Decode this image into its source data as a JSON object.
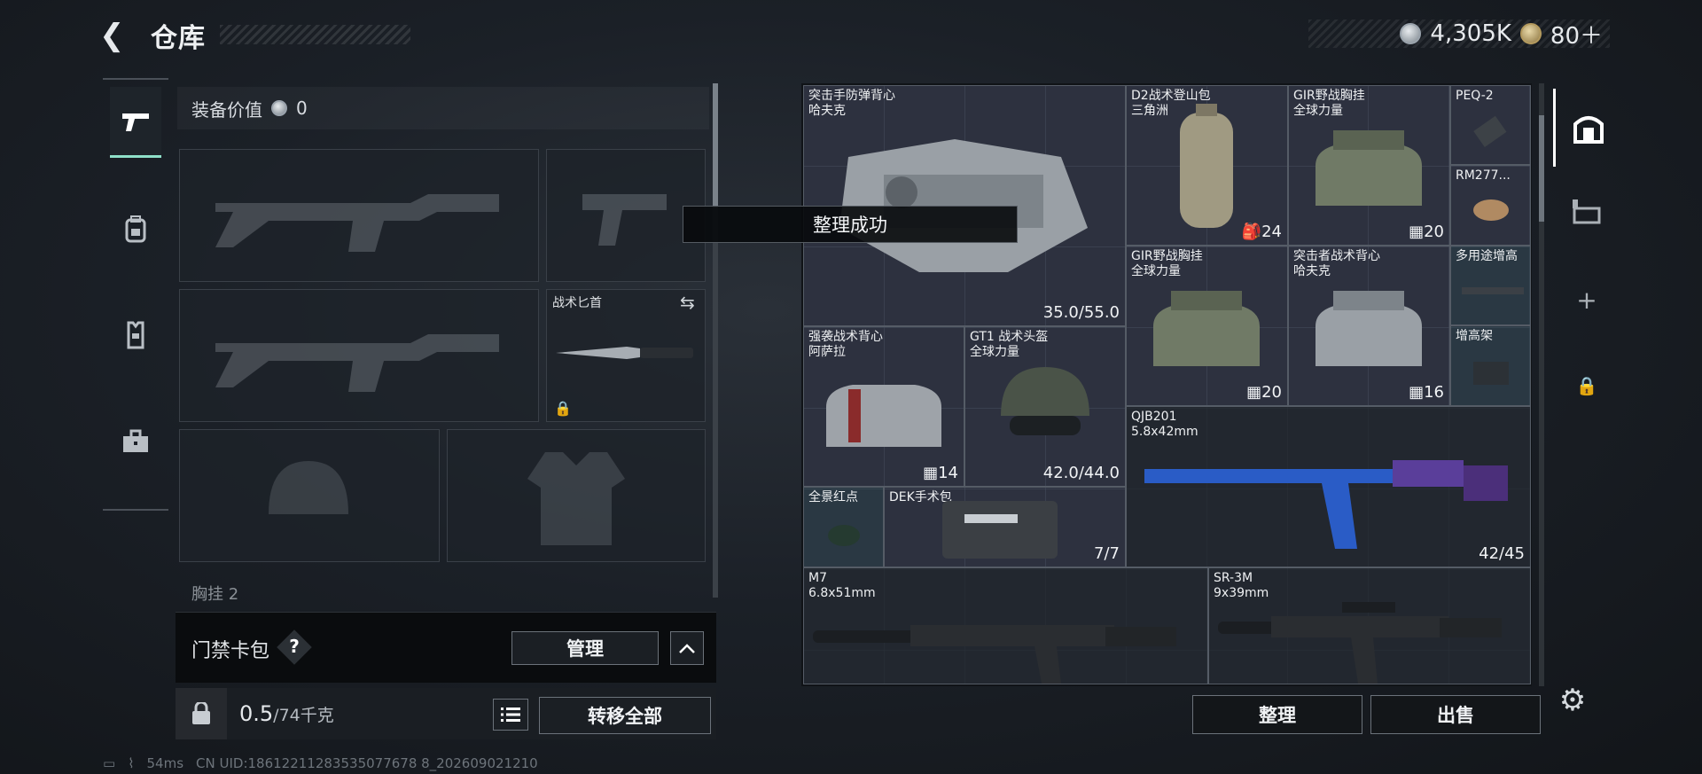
{
  "header": {
    "back_icon": "back-arrow-icon",
    "title": "仓库",
    "currency": [
      {
        "icon": "silver-coin-icon",
        "value": "4,305K"
      },
      {
        "icon": "gold-coin-icon",
        "value": "80＋"
      }
    ]
  },
  "tabs": [
    "pistol-icon",
    "backpack-icon",
    "vest-icon",
    "briefcase-icon"
  ],
  "loadout": {
    "equip_value_label": "装备价值",
    "equip_value": "0",
    "knife_label": "战术匕首",
    "vest_label": "胸挂",
    "vest_count": "2"
  },
  "card_bag": {
    "label": "门禁卡包",
    "help": "?",
    "manage": "管理"
  },
  "weight": {
    "current": "0.5",
    "max": "/74千克"
  },
  "transfer_all": "转移全部",
  "toast": "整理成功",
  "stash": {
    "items": [
      {
        "name": "突击手防弹背心\n哈夫克",
        "count": "35.0/55.0"
      },
      {
        "name": "D2战术登山包\n三角洲",
        "count": "24"
      },
      {
        "name": "GIR野战胸挂\n全球力量",
        "count": "20"
      },
      {
        "name": "PEQ-2",
        "count": ""
      },
      {
        "name": "RM277...",
        "count": ""
      },
      {
        "name": "GIR野战胸挂\n全球力量",
        "count": "20"
      },
      {
        "name": "突击者战术背心\n哈夫克",
        "count": "16"
      },
      {
        "name": "多用途增高",
        "count": ""
      },
      {
        "name": "增高架",
        "count": ""
      },
      {
        "name": "强袭战术背心\n阿萨拉",
        "count": "14"
      },
      {
        "name": "GT1 战术头盔\n全球力量",
        "count": "42.0/44.0"
      },
      {
        "name": "QJB201\n5.8x42mm",
        "count": "42/45"
      },
      {
        "name": "全景红点",
        "count": ""
      },
      {
        "name": "DEK手术包",
        "count": "7/7"
      },
      {
        "name": "M7\n6.8x51mm",
        "count": ""
      },
      {
        "name": "SR-3M\n9x39mm",
        "count": ""
      }
    ]
  },
  "actions": {
    "sort": "整理",
    "sell": "出售"
  },
  "footer": {
    "ping": "54ms",
    "uid": "CN UID:18612211283535077678 8_202609021210"
  },
  "colors": {
    "accent": "#8fe0c9",
    "item_bg": "#464a60",
    "toast_bg": "#08090c"
  }
}
